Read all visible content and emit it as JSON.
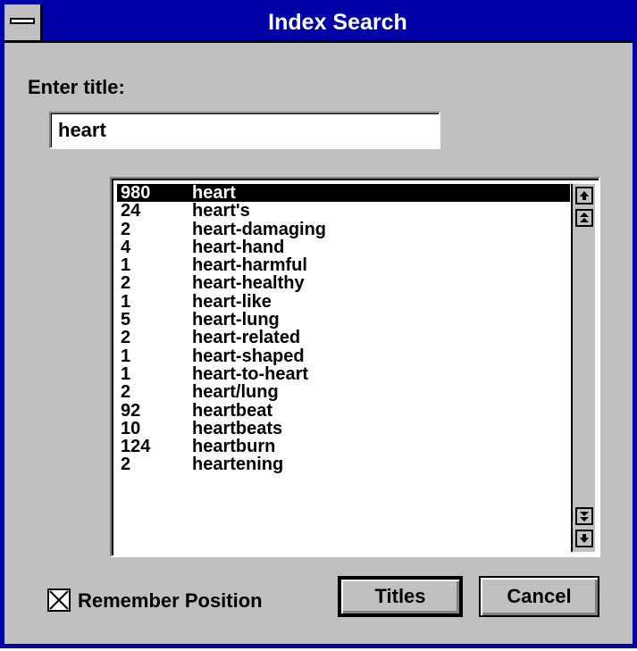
{
  "window": {
    "title": "Index Search"
  },
  "form": {
    "enter_title_label": "Enter title:",
    "title_input_value": "heart"
  },
  "list": {
    "items": [
      {
        "count": "980",
        "word": "heart",
        "selected": true
      },
      {
        "count": "24",
        "word": "heart's"
      },
      {
        "count": "2",
        "word": "heart-damaging"
      },
      {
        "count": "4",
        "word": "heart-hand"
      },
      {
        "count": "1",
        "word": "heart-harmful"
      },
      {
        "count": "2",
        "word": "heart-healthy"
      },
      {
        "count": "1",
        "word": "heart-like"
      },
      {
        "count": "5",
        "word": "heart-lung"
      },
      {
        "count": "2",
        "word": "heart-related"
      },
      {
        "count": "1",
        "word": "heart-shaped"
      },
      {
        "count": "1",
        "word": "heart-to-heart"
      },
      {
        "count": "2",
        "word": "heart/lung"
      },
      {
        "count": "92",
        "word": "heartbeat"
      },
      {
        "count": "10",
        "word": "heartbeats"
      },
      {
        "count": "124",
        "word": "heartburn"
      },
      {
        "count": "2",
        "word": "heartening"
      }
    ]
  },
  "options": {
    "remember_position_label": "Remember Position",
    "remember_position_checked": true
  },
  "buttons": {
    "titles_label": "Titles",
    "cancel_label": "Cancel"
  },
  "icons": {
    "system_menu": "system-menu-icon",
    "scroll_up": "arrow-up-icon",
    "page_up": "double-arrow-up-icon",
    "page_down": "double-arrow-down-icon",
    "scroll_down": "arrow-down-icon"
  },
  "colors": {
    "titlebar": "#0000a8",
    "dialog_face": "#c0c0c0",
    "selection": "#000000"
  }
}
